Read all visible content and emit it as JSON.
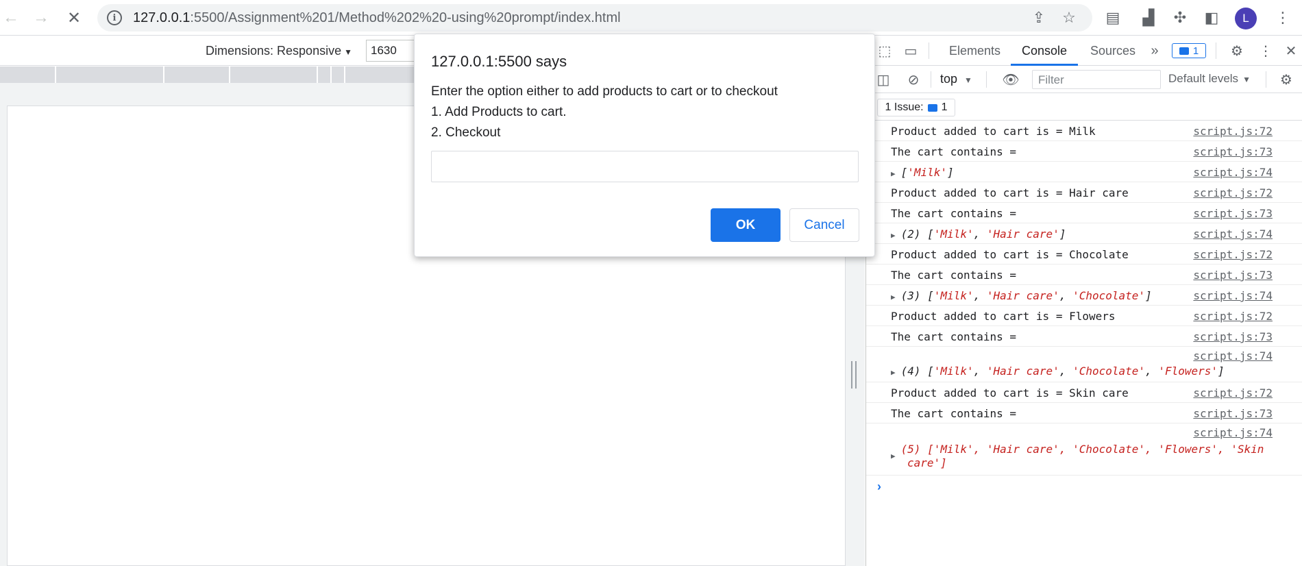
{
  "browser": {
    "url_host": "127.0.0.1",
    "url_rest": ":5500/Assignment%201/Method%202%20-using%20prompt/index.html",
    "avatar_letter": "L"
  },
  "device_toolbar": {
    "dimensions_label": "Dimensions: Responsive",
    "width_value": "1630"
  },
  "devtools": {
    "tabs": [
      "Elements",
      "Console",
      "Sources"
    ],
    "active_tab": "Console",
    "issue_badge_count": "1",
    "context": "top",
    "filter_placeholder": "Filter",
    "levels": "Default levels",
    "issues_label": "1 Issue:",
    "issues_count": "1"
  },
  "console_rows": {
    "r1_msg": "Product added to cart is = Milk",
    "r1_src": "script.js:72",
    "r2_msg": "The cart contains =",
    "r2_src": "script.js:73",
    "r3_src": "script.js:74",
    "r4_msg": "Product added to cart is = Hair care",
    "r4_src": "script.js:72",
    "r5_msg": "The cart contains =",
    "r5_src": "script.js:73",
    "r6_src": "script.js:74",
    "r7_msg": "Product added to cart is = Chocolate",
    "r7_src": "script.js:72",
    "r8_msg": "The cart contains =",
    "r8_src": "script.js:73",
    "r9_src": "script.js:74",
    "r10_msg": "Product added to cart is = Flowers",
    "r10_src": "script.js:72",
    "r11_msg": "The cart contains =",
    "r11_src": "script.js:73",
    "r12_src": "script.js:74",
    "r13_msg": "Product added to cart is = Skin care",
    "r13_src": "script.js:72",
    "r14_msg": "The cart contains =",
    "r14_src": "script.js:73",
    "r15_src": "script.js:74"
  },
  "arrays": {
    "a1": {
      "prefix": "",
      "items": [
        "'Milk'"
      ]
    },
    "a2": {
      "prefix": "(2) ",
      "items": [
        "'Milk'",
        "'Hair care'"
      ]
    },
    "a3": {
      "prefix": "(3) ",
      "items": [
        "'Milk'",
        "'Hair care'",
        "'Chocolate'"
      ]
    },
    "a4": {
      "prefix": "(4) ",
      "items": [
        "'Milk'",
        "'Hair care'",
        "'Chocolate'",
        "'Flowers'"
      ]
    },
    "a5_line1": "(5) ['Milk', 'Hair care', 'Chocolate', 'Flowers', 'Skin",
    "a5_line2": "care']"
  },
  "dialog": {
    "title": "127.0.0.1:5500 says",
    "line1": "Enter the option either to add products to cart or to checkout",
    "line2": "1. Add Products to cart.",
    "line3": "2. Checkout",
    "input_value": "",
    "ok_label": "OK",
    "cancel_label": "Cancel"
  },
  "colors": {
    "accent": "#1a73e8",
    "string": "#c5221f"
  }
}
